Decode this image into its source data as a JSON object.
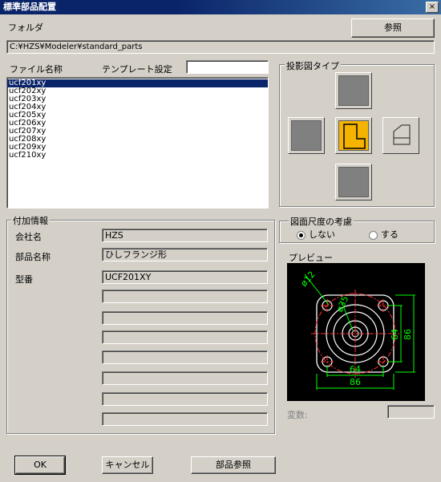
{
  "window": {
    "title": "標準部品配置",
    "close_glyph": "×"
  },
  "folder": {
    "label": "フォルダ",
    "browse_label": "参照",
    "path": "C:¥HZS¥Modeler¥standard_parts"
  },
  "file_list": {
    "header": "ファイル名称",
    "template_label": "テンプレート設定",
    "template_value": "",
    "items": [
      "ucf201xy",
      "ucf202xy",
      "ucf203xy",
      "ucf204xy",
      "ucf205xy",
      "ucf206xy",
      "ucf207xy",
      "ucf208xy",
      "ucf209xy",
      "ucf210xy"
    ],
    "selected": "ucf201xy"
  },
  "projection": {
    "title": "投影図タイプ",
    "selected": "center"
  },
  "extra_info": {
    "title": "付加情報",
    "company_label": "会社名",
    "company_value": "HZS",
    "part_name_label": "部品名称",
    "part_name_value": "ひしフランジ形",
    "model_label": "型番",
    "model_value": "UCF201XY",
    "blank_fields": [
      "",
      "",
      "",
      "",
      "",
      "",
      "",
      ""
    ]
  },
  "scale": {
    "title": "図面尺度の考慮",
    "option_no": "しない",
    "option_yes": "する",
    "selected": "しない"
  },
  "preview": {
    "title": "プレビュー",
    "dims": {
      "dia_bolt": "ø12",
      "dia_shaft": "ø35",
      "w1": "64",
      "w2": "86",
      "h1": "64",
      "h2": "86"
    },
    "colors": {
      "bg": "#000000",
      "body": "#ffffff",
      "dim": "#00ff00",
      "center": "#ff0000"
    }
  },
  "variable": {
    "label": "変数:",
    "value": ""
  },
  "buttons": {
    "ok": "OK",
    "cancel": "キャンセル",
    "part_browse": "部品参照"
  }
}
